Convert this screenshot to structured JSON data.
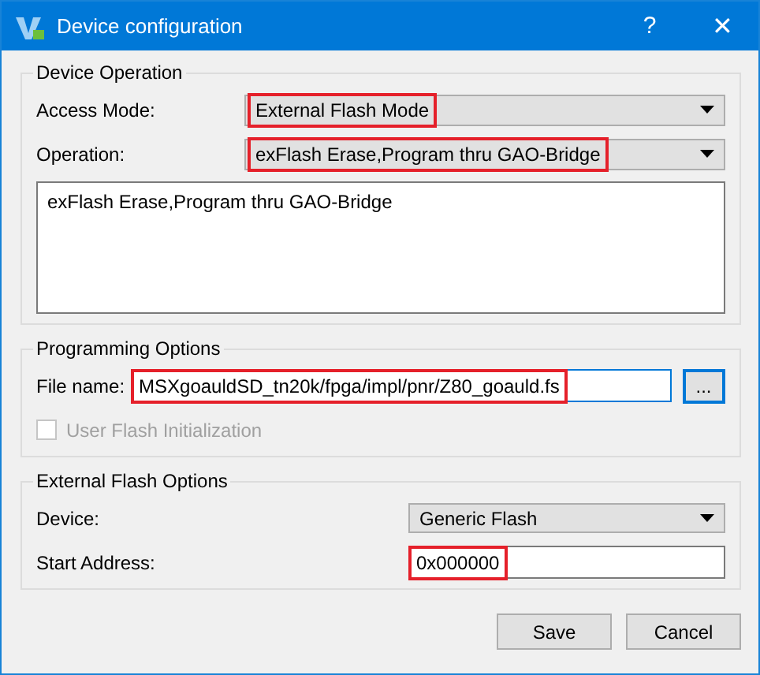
{
  "window": {
    "title": "Device configuration",
    "help": "?",
    "close": "✕"
  },
  "groups": [
    {
      "title": "Device Operation",
      "rows": [
        {
          "kind": "combo",
          "label": "Access Mode:",
          "value": "External Flash Mode",
          "highlighted": true,
          "wide": true
        },
        {
          "kind": "combo",
          "label": "Operation:",
          "value": "exFlash Erase,Program thru GAO-Bridge",
          "highlighted": true,
          "wide": true
        },
        {
          "kind": "textarea",
          "value": "exFlash Erase,Program thru GAO-Bridge"
        }
      ]
    },
    {
      "title": "Programming Options",
      "rows": [
        {
          "kind": "file",
          "label": "File name:",
          "value": "MSXgoauldSD_tn20k/fpga/impl/pnr/Z80_goauld.fs",
          "highlighted": true,
          "browse": "..."
        },
        {
          "kind": "checkbox",
          "label": "User Flash Initialization",
          "checked": false,
          "disabled": true
        }
      ]
    },
    {
      "title": "External Flash Options",
      "rows": [
        {
          "kind": "combo",
          "label": "Device:",
          "value": "Generic Flash",
          "highlighted": false,
          "wide": false
        },
        {
          "kind": "input",
          "label": "Start Address:",
          "value": "0x000000",
          "highlighted": true
        }
      ]
    }
  ],
  "buttons": [
    "Save",
    "Cancel"
  ]
}
